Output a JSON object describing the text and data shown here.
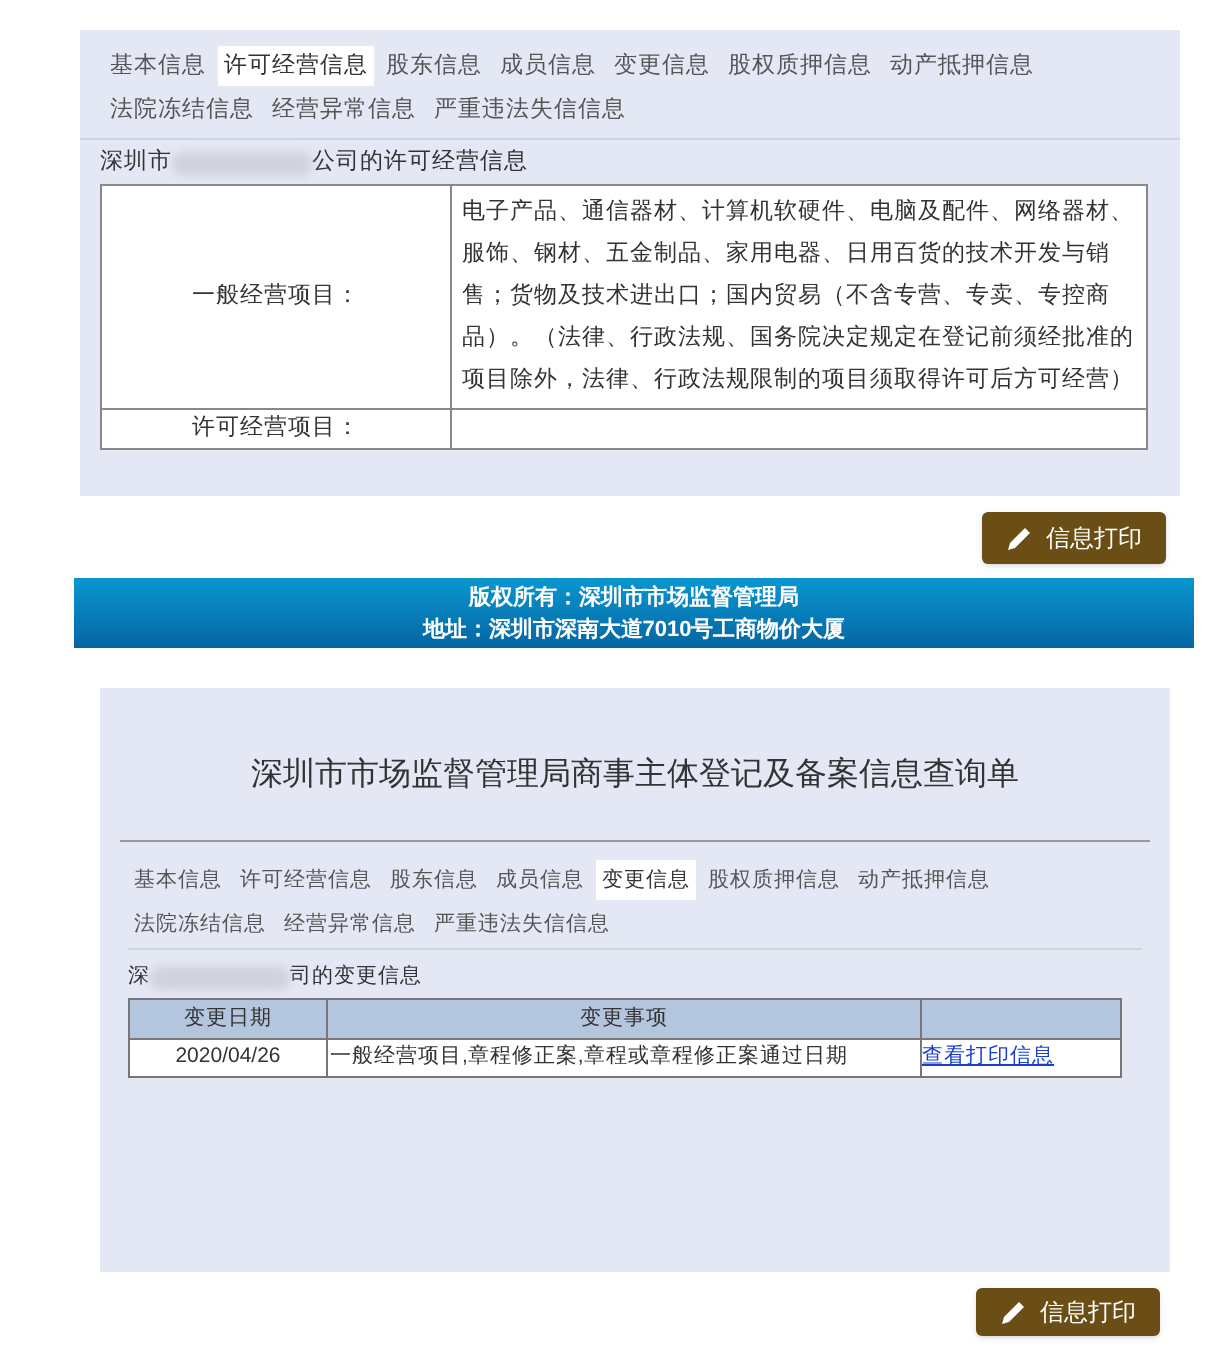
{
  "license_panel": {
    "tabs": [
      {
        "label": "基本信息",
        "selected": false
      },
      {
        "label": "许可经营信息",
        "selected": true
      },
      {
        "label": "股东信息",
        "selected": false
      },
      {
        "label": "成员信息",
        "selected": false
      },
      {
        "label": "变更信息",
        "selected": false
      },
      {
        "label": "股权质押信息",
        "selected": false
      },
      {
        "label": "动产抵押信息",
        "selected": false
      },
      {
        "label": "法院冻结信息",
        "selected": false
      },
      {
        "label": "经营异常信息",
        "selected": false
      },
      {
        "label": "严重违法失信信息",
        "selected": false
      }
    ],
    "heading_prefix": "深圳市",
    "heading_suffix": "公司的许可经营信息",
    "rows": [
      {
        "label": "一般经营项目：",
        "value": "电子产品、通信器材、计算机软硬件、电脑及配件、网络器材、服饰、钢材、五金制品、家用电器、日用百货的技术开发与销售；货物及技术进出口；国内贸易（不含专营、专卖、专控商品）。（法律、行政法规、国务院决定规定在登记前须经批准的项目除外，法律、行政法规限制的项目须取得许可后方可经营）"
      },
      {
        "label": "许可经营项目："
      }
    ]
  },
  "print_button_1": "信息打印",
  "footer": [
    "版权所有：深圳市市场监督管理局",
    "地址：深圳市深南大道7010号工商物价大厦"
  ],
  "change_panel": {
    "title": "深圳市市场监督管理局商事主体登记及备案信息查询单",
    "tabs": [
      {
        "label": "基本信息",
        "selected": false
      },
      {
        "label": "许可经营信息",
        "selected": false
      },
      {
        "label": "股东信息",
        "selected": false
      },
      {
        "label": "成员信息",
        "selected": false
      },
      {
        "label": "变更信息",
        "selected": true
      },
      {
        "label": "股权质押信息",
        "selected": false
      },
      {
        "label": "动产抵押信息",
        "selected": false
      },
      {
        "label": "法院冻结信息",
        "selected": false
      },
      {
        "label": "经营异常信息",
        "selected": false
      },
      {
        "label": "严重违法失信信息",
        "selected": false
      }
    ],
    "heading_prefix": "深",
    "heading_suffix": "司的变更信息",
    "table": {
      "columns": [
        "变更日期",
        "变更事项"
      ],
      "rows": [
        {
          "date": "2020/04/26",
          "item": "一般经营项目,章程修正案,章程或章程修正案通过日期",
          "link": "查看打印信息"
        }
      ]
    }
  },
  "print_button_2": "信息打印"
}
